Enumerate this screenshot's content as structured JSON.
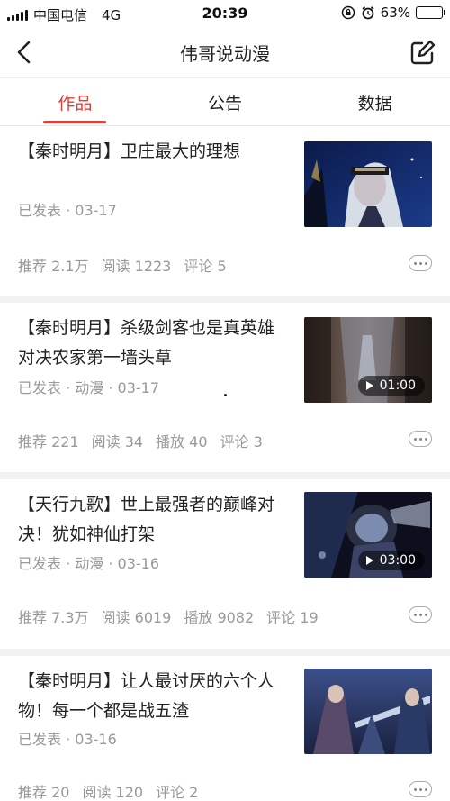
{
  "status_bar": {
    "carrier": "中国电信",
    "network": "4G",
    "time": "20:39",
    "battery": "63%",
    "battery_level": 0.63
  },
  "header": {
    "title": "伟哥说动漫"
  },
  "tabs": [
    {
      "label": "作品",
      "active": true
    },
    {
      "label": "公告",
      "active": false
    },
    {
      "label": "数据",
      "active": false
    }
  ],
  "colors": {
    "accent": "#e0403a",
    "meta_text": "#999999",
    "separator": "#f2f2f2"
  },
  "articles": [
    {
      "title": "【秦时明月】卫庄最大的理想",
      "meta": "已发表 · 03-17",
      "stats": [
        "推荐 2.1万",
        "阅读 1223",
        "评论 5"
      ],
      "duration": null
    },
    {
      "title": "【秦时明月】杀级剑客也是真英雄　对决农家第一墙头草",
      "meta": "已发表 · 动漫 · 03-17",
      "stats": [
        "推荐 221",
        "阅读 34",
        "播放 40",
        "评论 3"
      ],
      "duration": "01:00"
    },
    {
      "title": "【天行九歌】世上最强者的巅峰对决！犹如神仙打架",
      "meta": "已发表 · 动漫 · 03-16",
      "stats": [
        "推荐 7.3万",
        "阅读 6019",
        "播放 9082",
        "评论 19"
      ],
      "duration": "03:00"
    },
    {
      "title": "【秦时明月】让人最讨厌的六个人物！每一个都是战五渣",
      "meta": "已发表 · 03-16",
      "stats": [
        "推荐 20",
        "阅读 120",
        "评论 2"
      ],
      "duration": null
    }
  ]
}
